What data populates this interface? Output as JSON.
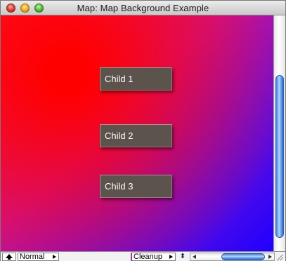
{
  "window": {
    "title": "Map: Map Background Example"
  },
  "canvas": {
    "background": {
      "center_color": "#ff0000",
      "outer_color": "#1f00ff"
    },
    "nodes": [
      {
        "label": "Child 1"
      },
      {
        "label": "Child 2"
      },
      {
        "label": "Child 3"
      }
    ]
  },
  "toolbar": {
    "up_icon": "up-arrow-icon",
    "view_mode": "Normal",
    "cleanup_label": "Cleanup",
    "zoom_icon": "zoom-icon"
  },
  "colors": {
    "node_fill": "#5c534c",
    "node_text": "#ffffff",
    "scroll_thumb": "#4a8be6"
  }
}
